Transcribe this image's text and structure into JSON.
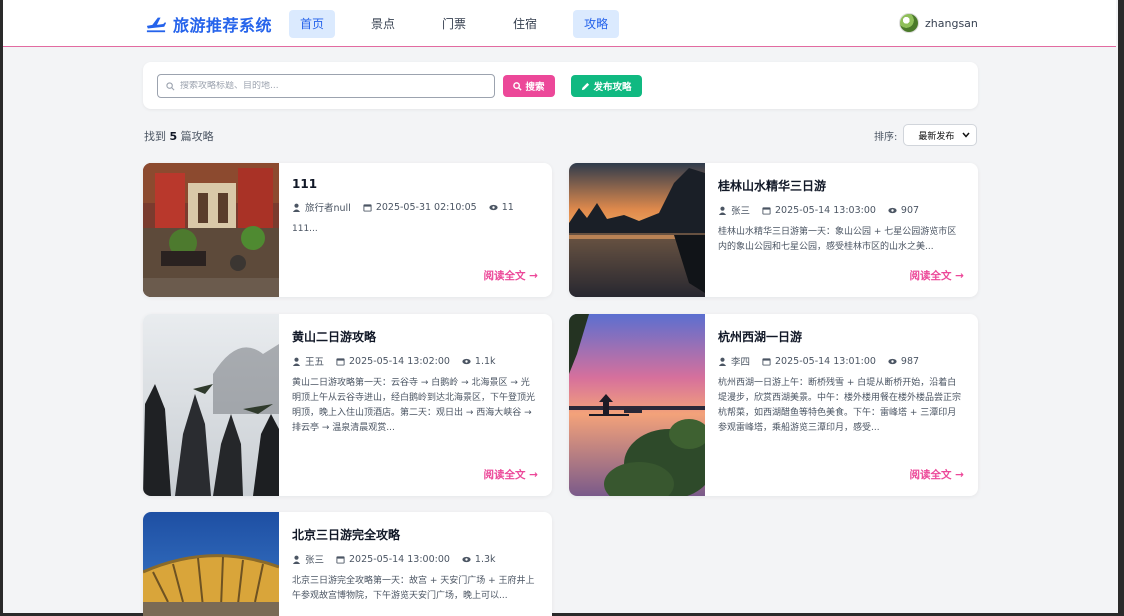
{
  "brand": {
    "title": "旅游推荐系统",
    "color": "#2563eb"
  },
  "nav": [
    "首页",
    "景点",
    "门票",
    "住宿",
    "攻略"
  ],
  "user": {
    "name": "zhangsan"
  },
  "search": {
    "placeholder": "搜索攻略标题、目的地...",
    "value": ""
  },
  "buttons": {
    "search": "搜索",
    "publish": "发布攻略"
  },
  "result": {
    "prefix": "找到",
    "count": "5",
    "suffix": "篇攻略"
  },
  "sort": {
    "label": "排序:",
    "selected": "最新发布"
  },
  "read_more": "阅读全文 →",
  "articles": [
    {
      "title": "111",
      "author": "旅行者null",
      "date": "2025-05-31 02:10:05",
      "views": "11",
      "excerpt": "111..."
    },
    {
      "title": "桂林山水精华三日游",
      "author": "张三",
      "date": "2025-05-14 13:03:00",
      "views": "907",
      "excerpt": "桂林山水精华三日游第一天：象山公园 + 七星公园游览市区内的象山公园和七星公园，感受桂林市区的山水之美..."
    },
    {
      "title": "黄山二日游攻略",
      "author": "王五",
      "date": "2025-05-14 13:02:00",
      "views": "1.1k",
      "excerpt": "黄山二日游攻略第一天：云谷寺 → 白鹅岭 → 北海景区 → 光明顶上午从云谷寺进山，经白鹅岭到达北海景区，下午登顶光明顶，晚上入住山顶酒店。第二天：观日出 → 西海大峡谷 → 排云亭 → 温泉清晨观赏..."
    },
    {
      "title": "杭州西湖一日游",
      "author": "李四",
      "date": "2025-05-14 13:01:00",
      "views": "987",
      "excerpt": "杭州西湖一日游上午：断桥残雪 + 白堤从断桥开始，沿着白堤漫步，欣赏西湖美景。中午：楼外楼用餐在楼外楼品尝正宗杭帮菜，如西湖醋鱼等特色美食。下午：雷峰塔 + 三潭印月参观雷峰塔，乘船游览三潭印月，感受..."
    },
    {
      "title": "北京三日游完全攻略",
      "author": "张三",
      "date": "2025-05-14 13:00:00",
      "views": "1.3k",
      "excerpt": "北京三日游完全攻略第一天：故宫 + 天安门广场 + 王府井上午参观故宫博物院，下午游览天安门广场，晚上可以..."
    }
  ],
  "colors": {
    "accent_pink": "#ec4899",
    "accent_green": "#10b981",
    "nav_active_bg": "#dbeafe"
  }
}
